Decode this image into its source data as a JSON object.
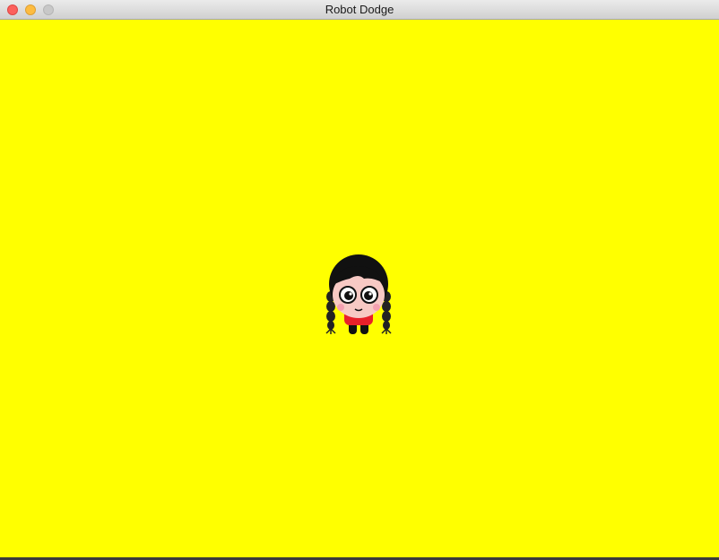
{
  "window": {
    "title": "Robot Dodge"
  },
  "game": {
    "background_color": "#ffff00",
    "player": {
      "icon": "girl-character-icon"
    }
  }
}
